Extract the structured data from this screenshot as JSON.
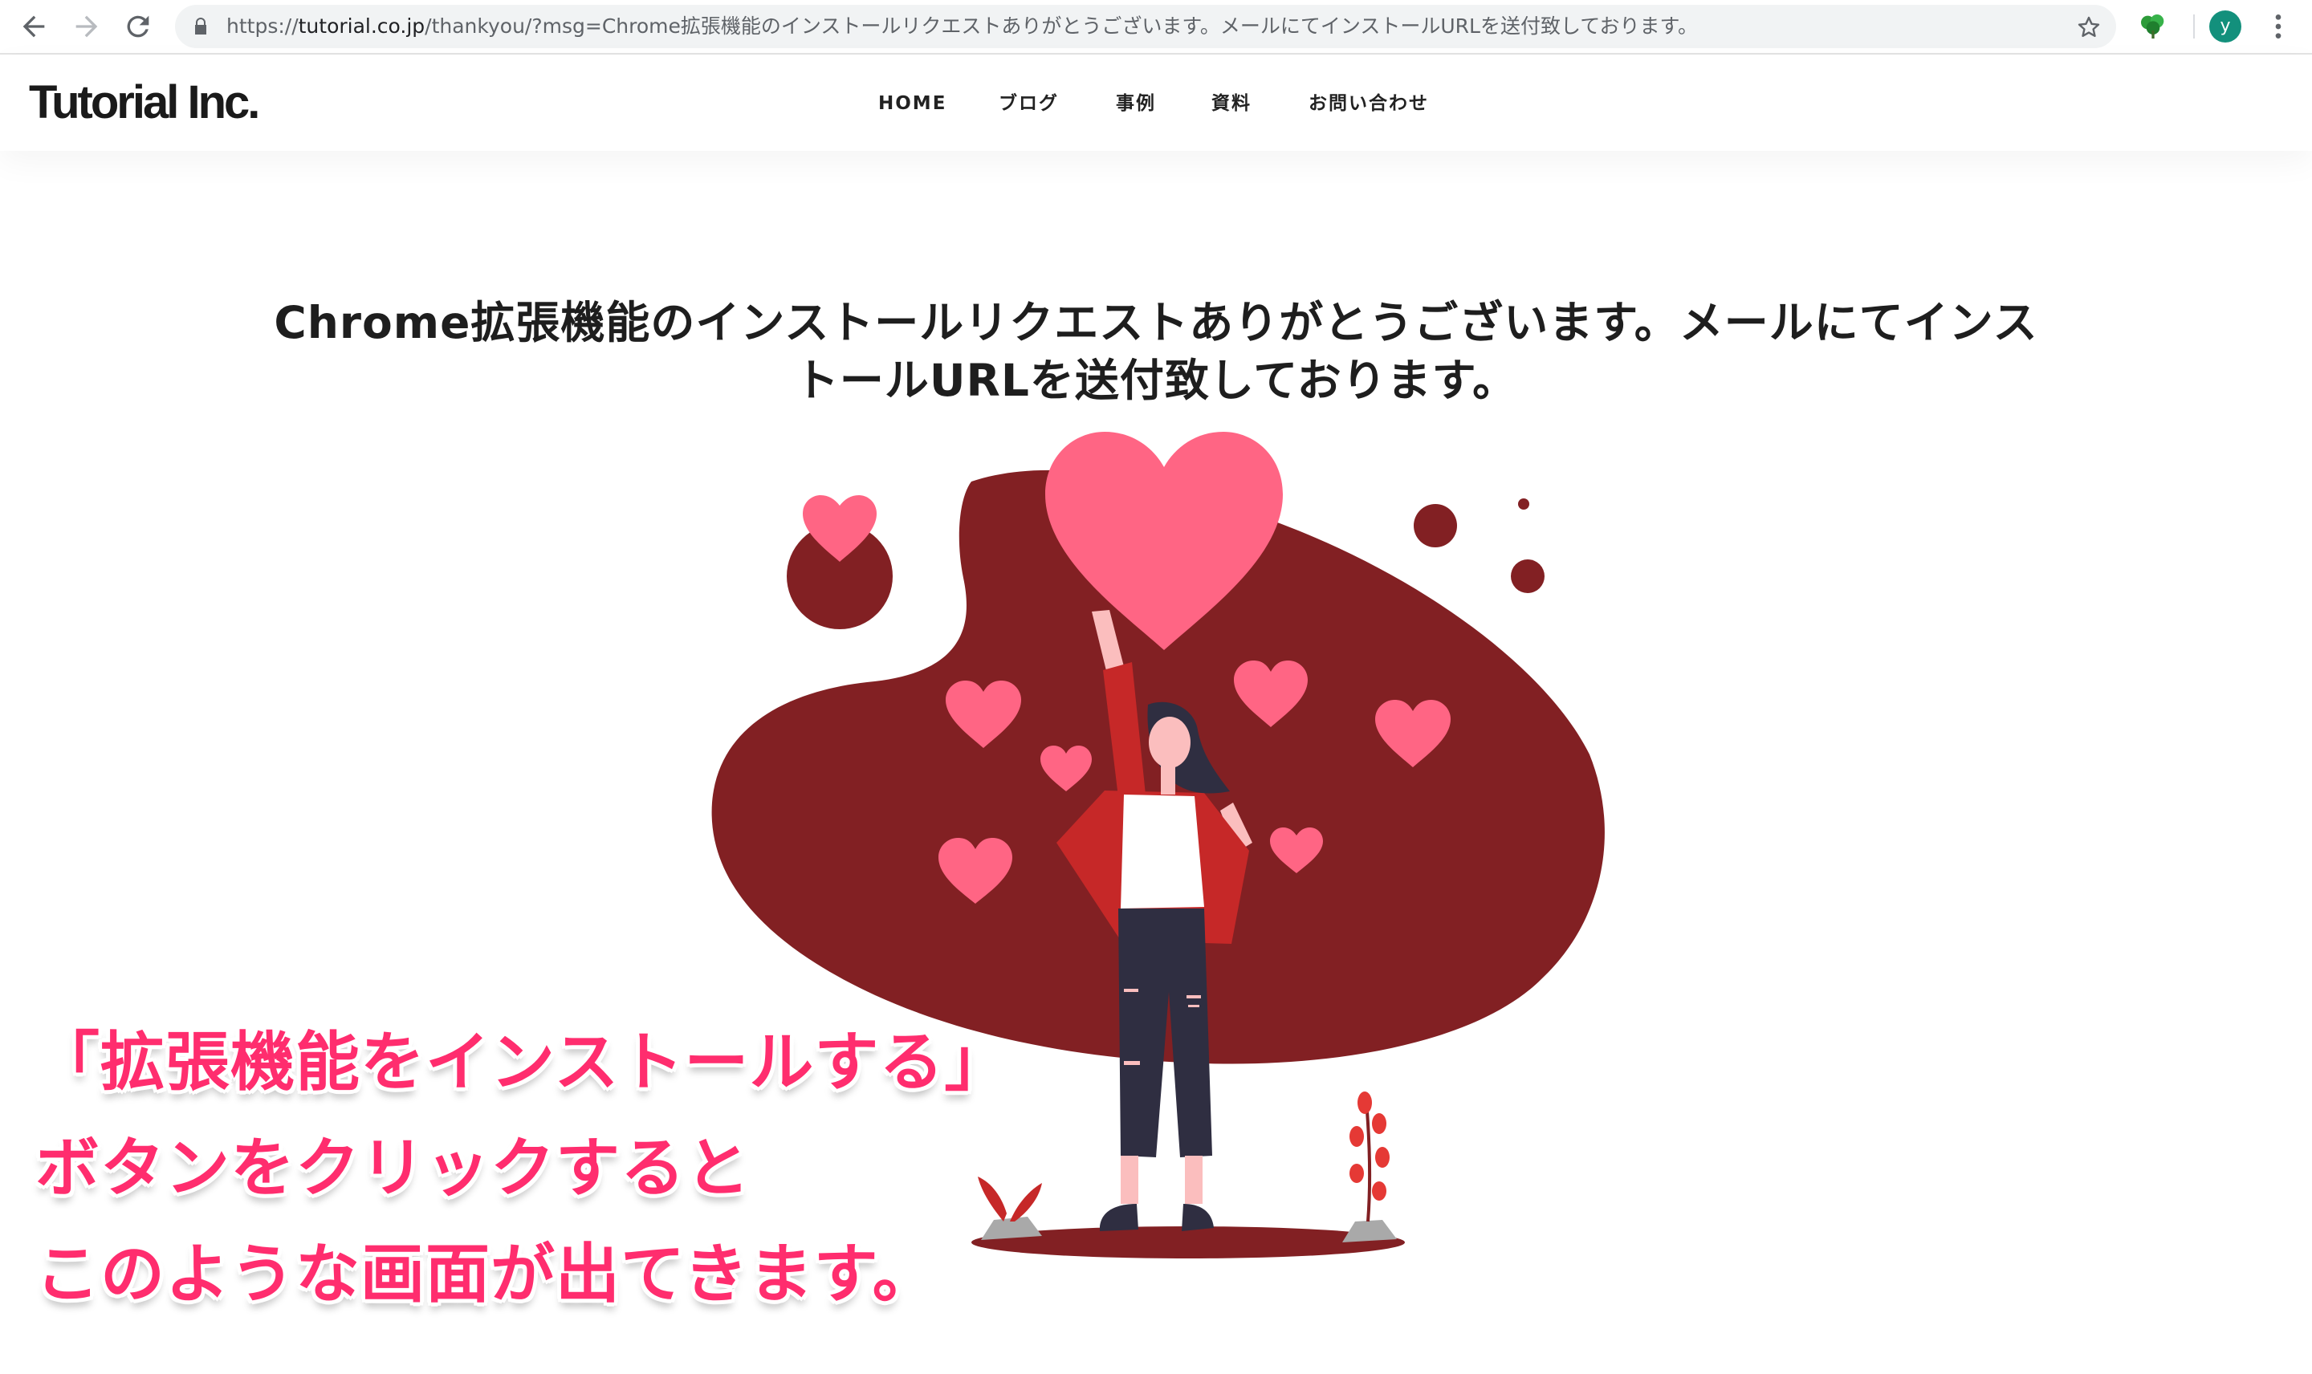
{
  "browser": {
    "url_scheme": "https://",
    "url_host": "tutorial.co.jp",
    "url_rest": "/thankyou/?msg=Chrome拡張機能のインストールリクエストありがとうございます。メールにてインストールURLを送付致しております。",
    "profile_initial": "y",
    "icons": [
      "back-icon",
      "forward-icon",
      "reload-icon",
      "lock-icon",
      "star-icon",
      "extension-icon",
      "menu-icon"
    ]
  },
  "site": {
    "logo": "Tutorial Inc.",
    "nav": [
      "HOME",
      "ブログ",
      "事例",
      "資料",
      "お問い合わせ"
    ]
  },
  "main": {
    "message_line1": "Chrome拡張機能のインストールリクエストありがとうございます。メールにてインス",
    "message_line2": "トールURLを送付致しております。"
  },
  "annotation": {
    "lines": [
      "「拡張機能をインストールする」",
      "ボタンをクリックすると",
      "このような画面が出てきます。"
    ],
    "color": "#ff2d6e"
  },
  "colors": {
    "blob": "#822023",
    "heart": "#ff6584",
    "profile": "#13907c"
  }
}
